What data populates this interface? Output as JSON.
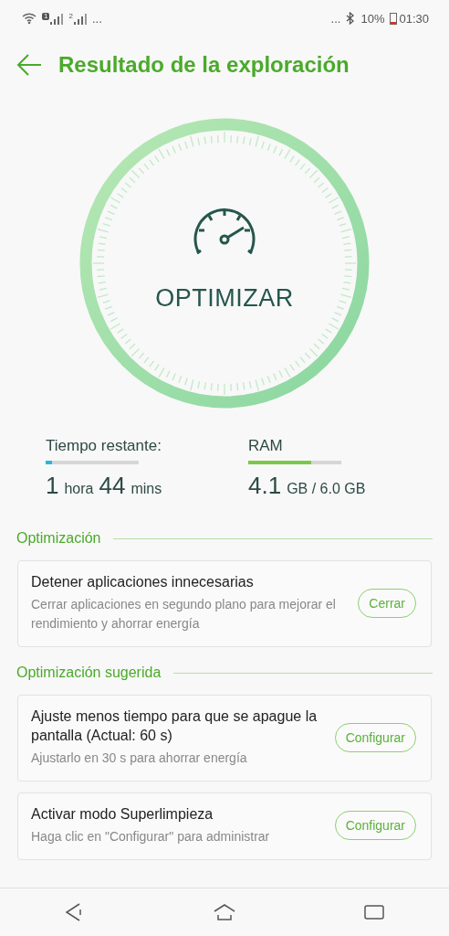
{
  "status_bar": {
    "sim_labels": [
      "1",
      "2"
    ],
    "left_more": "...",
    "right_more": "...",
    "battery_text": "10%",
    "time": "01:30"
  },
  "header": {
    "title": "Resultado de la exploración"
  },
  "gauge": {
    "label": "OPTIMIZAR"
  },
  "stats": [
    {
      "label": "Tiempo restante:",
      "level": 0.07,
      "color": "#29b6d8",
      "parts": [
        {
          "kind": "num",
          "text": "1"
        },
        {
          "kind": "unit",
          "text": "hora"
        },
        {
          "kind": "num",
          "text": "44"
        },
        {
          "kind": "unit",
          "text": "mins"
        }
      ]
    },
    {
      "label": "RAM",
      "level": 0.68,
      "color": "#7cc84a",
      "parts": [
        {
          "kind": "num",
          "text": "4.1"
        },
        {
          "kind": "unit",
          "text": "GB / 6.0 GB"
        }
      ]
    }
  ],
  "sections": [
    {
      "title": "Optimización",
      "cards": [
        {
          "title": "Detener aplicaciones innecesarias",
          "description": "Cerrar aplicaciones en segundo plano para mejorar el rendimiento y ahorrar energía",
          "button": "Cerrar"
        }
      ]
    },
    {
      "title": "Optimización sugerida",
      "cards": [
        {
          "title": "Ajuste menos tiempo para que se apague la pantalla (Actual: 60 s)",
          "description": "Ajustarlo en 30 s para ahorrar energía",
          "button": "Configurar"
        },
        {
          "title": "Activar modo Superlimpieza",
          "description": "Haga clic en \"Configurar\" para administrar",
          "button": "Configurar"
        }
      ]
    }
  ]
}
